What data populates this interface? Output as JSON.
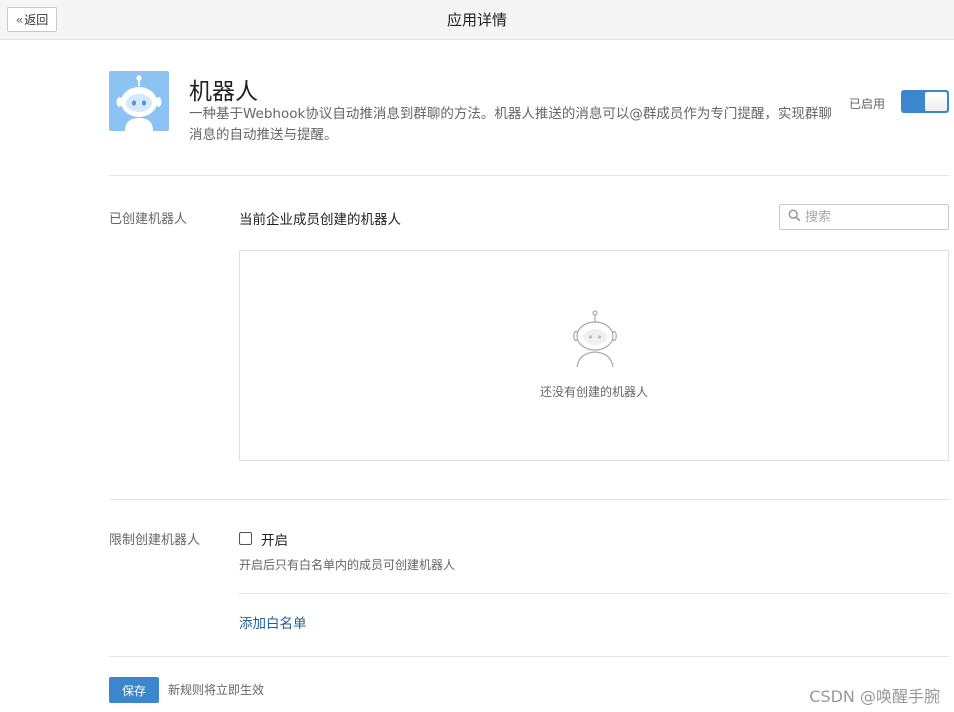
{
  "header": {
    "back_label": "返回",
    "title": "应用详情"
  },
  "app": {
    "icon": "robot-icon",
    "name": "机器人",
    "description": "一种基于Webhook协议自动推消息到群聊的方法。机器人推送的消息可以@群成员作为专门提醒，实现群聊消息的自动推送与提醒。",
    "status_label": "已启用",
    "enabled": true,
    "accent_color": "#3b86cc"
  },
  "created_robots": {
    "section_label": "已创建机器人",
    "sub_title": "当前企业成员创建的机器人",
    "search": {
      "placeholder": "搜索",
      "value": ""
    },
    "empty_icon": "robot-outline-icon",
    "empty_text": "还没有创建的机器人"
  },
  "restrict": {
    "section_label": "限制创建机器人",
    "checkbox_label": "开启",
    "checked": false,
    "hint": "开启后只有白名单内的成员可创建机器人",
    "whitelist_link": "添加白名单"
  },
  "footer": {
    "save_label": "保存",
    "note": "新规则将立即生效"
  },
  "watermark": "CSDN @唤醒手腕"
}
